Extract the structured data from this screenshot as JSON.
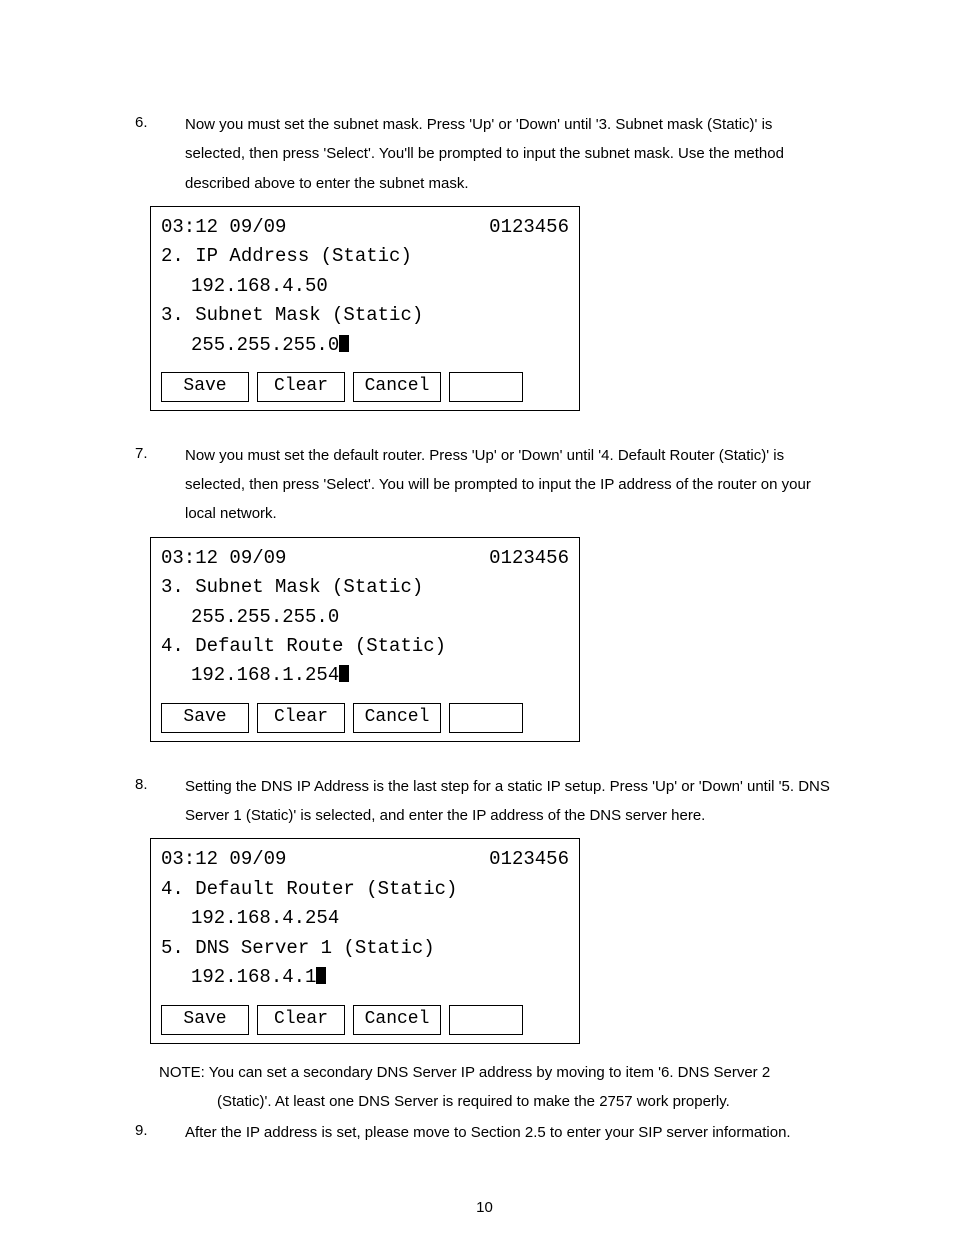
{
  "steps": {
    "s6": {
      "num": "6.",
      "text": "Now you must set the subnet mask. Press 'Up' or 'Down'   until '3. Subnet mask (Static)' is selected, then press 'Select'. You'll be prompted to input the subnet mask. Use the method described above to enter the subnet mask."
    },
    "s7": {
      "num": "7.",
      "text": "Now you must set the default router. Press 'Up' or 'Down' until '4. Default Router (Static)' is selected, then press 'Select'. You will be prompted to input the IP address of the router on your local network."
    },
    "s8": {
      "num": "8.",
      "text": "Setting the DNS IP Address is the last step for a static IP setup. Press 'Up' or 'Down' until '5. DNS Server 1 (Static)' is selected, and enter the IP address of the DNS server here."
    },
    "s9": {
      "num": "9.",
      "text": "After the IP address is set, please move to Section 2.5 to enter your SIP server information."
    }
  },
  "note": {
    "line1": "NOTE: You can set a secondary DNS Server IP address by moving to item '6. DNS Server 2",
    "line2": "(Static)'. At least one DNS Server is required to make the 2757 work properly."
  },
  "lcd_common": {
    "time": "03:12 09/09",
    "ext": "0123456",
    "save": "Save",
    "clear": "Clear",
    "cancel": "Cancel"
  },
  "lcd1": {
    "l1": "2. IP Address (Static)",
    "v1": "192.168.4.50",
    "l2": "3. Subnet Mask (Static)",
    "v2": "255.255.255.0"
  },
  "lcd2": {
    "l1": "3. Subnet Mask (Static)",
    "v1": "255.255.255.0",
    "l2": "4. Default Route (Static)",
    "v2": "192.168.1.254"
  },
  "lcd3": {
    "l1": "4. Default Router (Static)",
    "v1": "192.168.4.254",
    "l2": "5. DNS Server 1 (Static)",
    "v2": "192.168.4.1"
  },
  "page_number": "10"
}
